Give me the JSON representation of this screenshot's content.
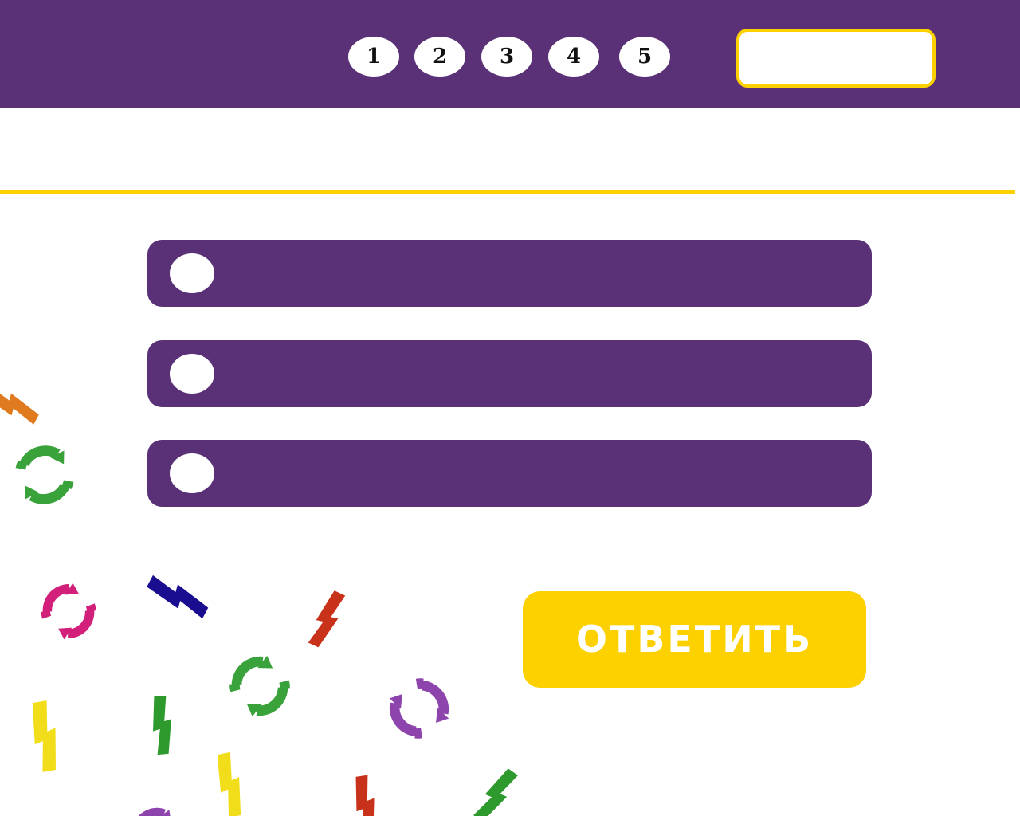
{
  "colors": {
    "purple": "#5a3076",
    "yellow": "#fdd000",
    "white": "#ffffff"
  },
  "header": {
    "steps": [
      "1",
      "2",
      "3",
      "4",
      "5"
    ],
    "score_value": ""
  },
  "question": {
    "text": ""
  },
  "options": [
    {
      "label": ""
    },
    {
      "label": ""
    },
    {
      "label": ""
    }
  ],
  "submit": {
    "label": "ОТВЕТИТЬ"
  },
  "decorations": {
    "ring_icon": "refresh-ring-icon",
    "bolt_icon": "lightning-bolt-icon",
    "colors": [
      "#e07a1f",
      "#3aa23a",
      "#d21f7a",
      "#1a0d8f",
      "#c8321a",
      "#8e44ad",
      "#f2dd1a",
      "#2e9a2e"
    ]
  }
}
